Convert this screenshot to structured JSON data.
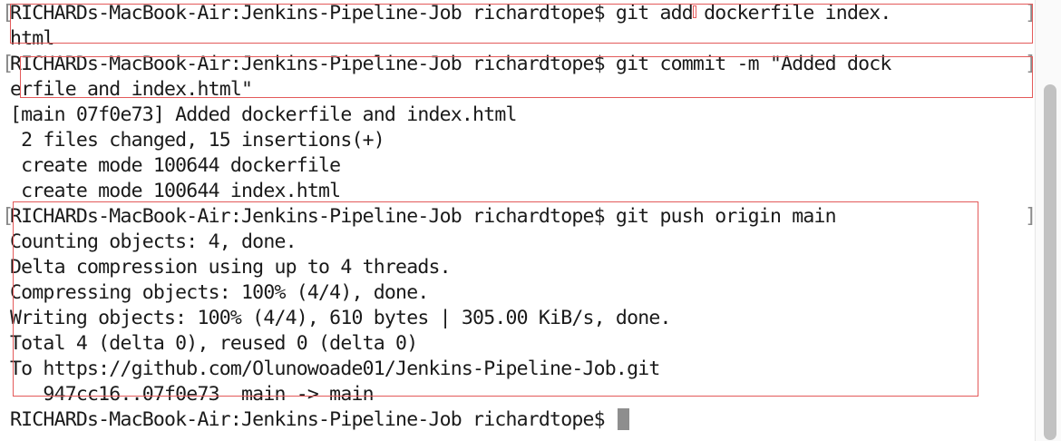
{
  "terminal": {
    "lines": [
      "RICHARDs-MacBook-Air:Jenkins-Pipeline-Job richardtope$ git add dockerfile index.",
      "html",
      "RICHARDs-MacBook-Air:Jenkins-Pipeline-Job richardtope$ git commit -m \"Added dock",
      "erfile and index.html\"",
      "[main 07f0e73] Added dockerfile and index.html",
      " 2 files changed, 15 insertions(+)",
      " create mode 100644 dockerfile",
      " create mode 100644 index.html",
      "RICHARDs-MacBook-Air:Jenkins-Pipeline-Job richardtope$ git push origin main",
      "Counting objects: 4, done.",
      "Delta compression using up to 4 threads.",
      "Compressing objects: 100% (4/4), done.",
      "Writing objects: 100% (4/4), 610 bytes | 305.00 KiB/s, done.",
      "Total 4 (delta 0), reused 0 (delta 0)",
      "To https://github.com/Olunowoade01/Jenkins-Pipeline-Job.git",
      "   947cc16..07f0e73  main -> main",
      "RICHARDs-MacBook-Air:Jenkins-Pipeline-Job richardtope$ "
    ]
  },
  "colors": {
    "text": "#1a1a1a",
    "highlight_box": "#e35a5a",
    "cursor": "#8e8e8e",
    "scroll_thumb": "#c2c2c2"
  }
}
